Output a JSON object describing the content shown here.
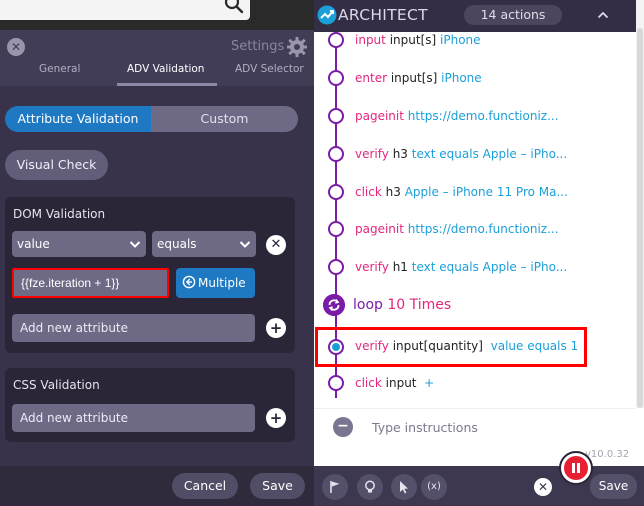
{
  "editor": {
    "title": "Settings",
    "tabs": [
      {
        "label": "General"
      },
      {
        "label": "ADV Validation",
        "active": true
      },
      {
        "label": "ADV Selector"
      }
    ],
    "segments": {
      "attribute": "Attribute Validation",
      "custom": "Custom"
    },
    "visual_check": "Visual Check",
    "dom_validation": {
      "title": "DOM Validation",
      "attribute_select": "value",
      "operator_select": "equals",
      "value_input": "{{fze.iteration + 1}}",
      "multiple_label": "Multiple",
      "add_attribute_placeholder": "Add new attribute"
    },
    "css_validation": {
      "title": "CSS Validation",
      "add_attribute_placeholder": "Add new attribute"
    },
    "footer": {
      "cancel": "Cancel",
      "save": "Save"
    }
  },
  "architect": {
    "title": "ARCHITECT",
    "actions_count": "14 actions",
    "steps": [
      {
        "kw": "input",
        "target": "input[s]",
        "arg": "iPhone"
      },
      {
        "kw": "enter",
        "target": "input[s]",
        "arg": "iPhone"
      },
      {
        "kw": "pageinit",
        "target": "",
        "arg": "https://demo.functioniz..."
      },
      {
        "kw": "verify",
        "target": "h3",
        "arg": "text equals Apple – iPho..."
      },
      {
        "kw": "click",
        "target": "h3",
        "arg": "Apple – iPhone 11 Pro Ma..."
      },
      {
        "kw": "pageinit",
        "target": "",
        "arg": "https://demo.functioniz..."
      },
      {
        "kw": "verify",
        "target": "h1",
        "arg": "text equals Apple – iPho..."
      }
    ],
    "loop": {
      "label": "loop",
      "count": "10 Times"
    },
    "loop_steps": [
      {
        "kw": "verify",
        "target": "input[quantity]",
        "arg": "value equals 1",
        "highlighted": true
      },
      {
        "kw": "click",
        "target": "input",
        "arg": "+"
      }
    ],
    "instructions_placeholder": "Type instructions",
    "version": "v10.0.32",
    "tools": {
      "variables": "(x)"
    },
    "save": "Save"
  },
  "colors": {
    "accent_blue": "#1e78c2",
    "keyword_pink": "#e3267e",
    "argument_blue": "#1c9fd8",
    "timeline_purple": "#7a1ca8",
    "highlight_red": "#ff0000",
    "record_red": "#e81e32"
  }
}
